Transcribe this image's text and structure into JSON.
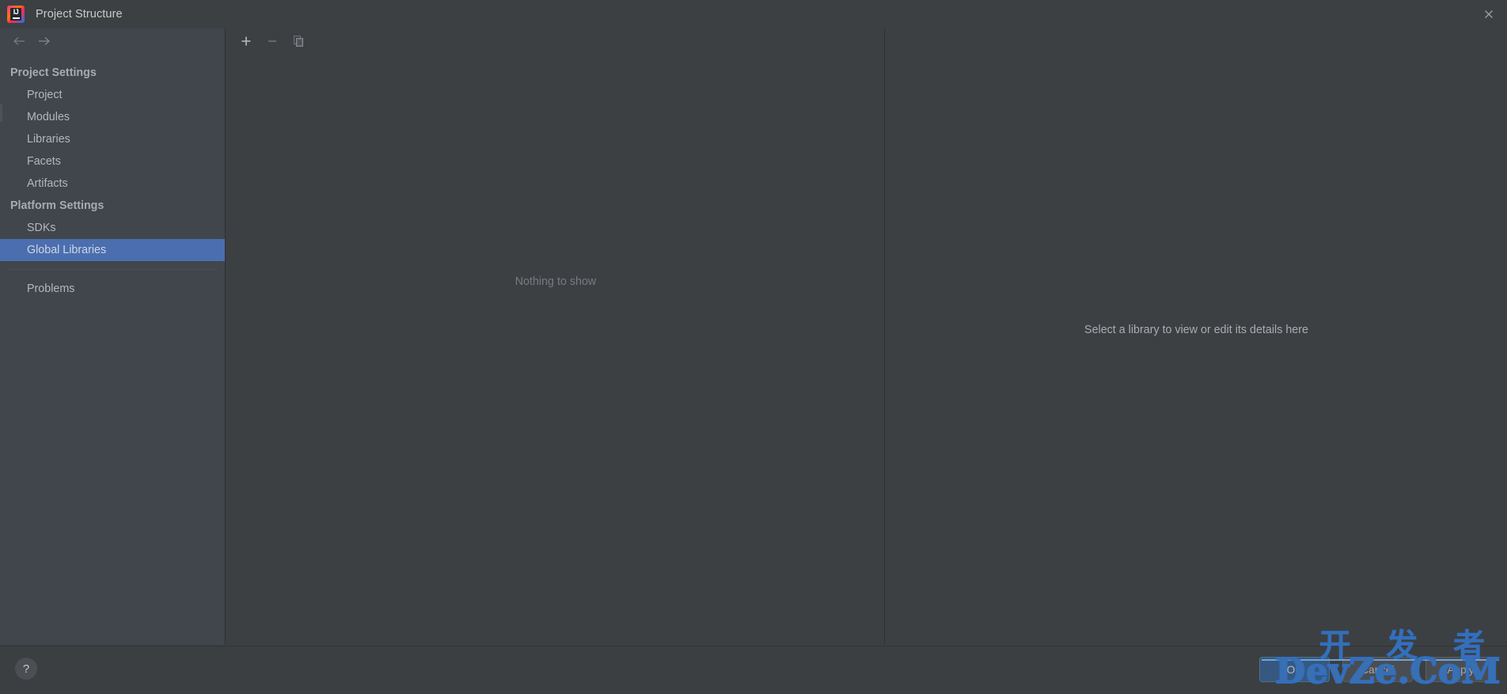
{
  "window": {
    "title": "Project Structure",
    "app_icon": "intellij-idea-icon",
    "close_icon": "close-icon"
  },
  "sidebar": {
    "nav": {
      "back_icon": "arrow-left-icon",
      "forward_icon": "arrow-right-icon"
    },
    "groups": [
      {
        "label": "Project Settings",
        "items": [
          {
            "label": "Project",
            "selected": false
          },
          {
            "label": "Modules",
            "selected": false
          },
          {
            "label": "Libraries",
            "selected": false
          },
          {
            "label": "Facets",
            "selected": false
          },
          {
            "label": "Artifacts",
            "selected": false
          }
        ]
      },
      {
        "label": "Platform Settings",
        "items": [
          {
            "label": "SDKs",
            "selected": false
          },
          {
            "label": "Global Libraries",
            "selected": true
          }
        ]
      }
    ],
    "extra_items": [
      {
        "label": "Problems",
        "selected": false
      }
    ]
  },
  "center_panel": {
    "toolbar": [
      {
        "name": "add-button",
        "icon": "plus-icon",
        "enabled": true
      },
      {
        "name": "remove-button",
        "icon": "minus-icon",
        "enabled": false
      },
      {
        "name": "copy-button",
        "icon": "copy-icon",
        "enabled": false
      }
    ],
    "empty_message": "Nothing to show"
  },
  "right_panel": {
    "empty_message": "Select a library to view or edit its details here"
  },
  "footer": {
    "help_label": "?",
    "buttons": [
      {
        "label": "OK",
        "style": "default"
      },
      {
        "label": "Cancel",
        "style": "plain"
      },
      {
        "label": "Apply",
        "style": "plain"
      }
    ]
  },
  "watermark": {
    "chinese": "开 发 者",
    "latin": "DevZe.CoM"
  },
  "colors": {
    "titlebar_bg": "#3c4043",
    "sidebar_bg": "#41454c",
    "panel_bg": "#3c4043",
    "footer_bg": "#3c3f41",
    "selection_blue": "#4b6eaf",
    "default_button_blue": "#365880",
    "text_primary": "#bbbbbb",
    "text_muted": "#787b80",
    "watermark_blue": "#3b6fae"
  }
}
